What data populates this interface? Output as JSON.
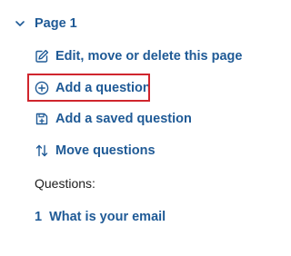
{
  "page": {
    "title": "Page 1",
    "expanded_icon": "chevron-down-icon"
  },
  "actions": [
    {
      "label": "Edit, move or delete this page",
      "icon": "edit-icon"
    },
    {
      "label": "Add a question",
      "icon": "add-circle-icon"
    },
    {
      "label": "Add a saved question",
      "icon": "save-icon"
    },
    {
      "label": "Move questions",
      "icon": "sort-arrows-icon"
    }
  ],
  "questions": {
    "label": "Questions:",
    "items": [
      {
        "number": "1",
        "text": "What is your email"
      }
    ]
  },
  "colors": {
    "link": "#1f5a96",
    "highlight_border": "#d0252d",
    "text": "#1d1d1d"
  }
}
